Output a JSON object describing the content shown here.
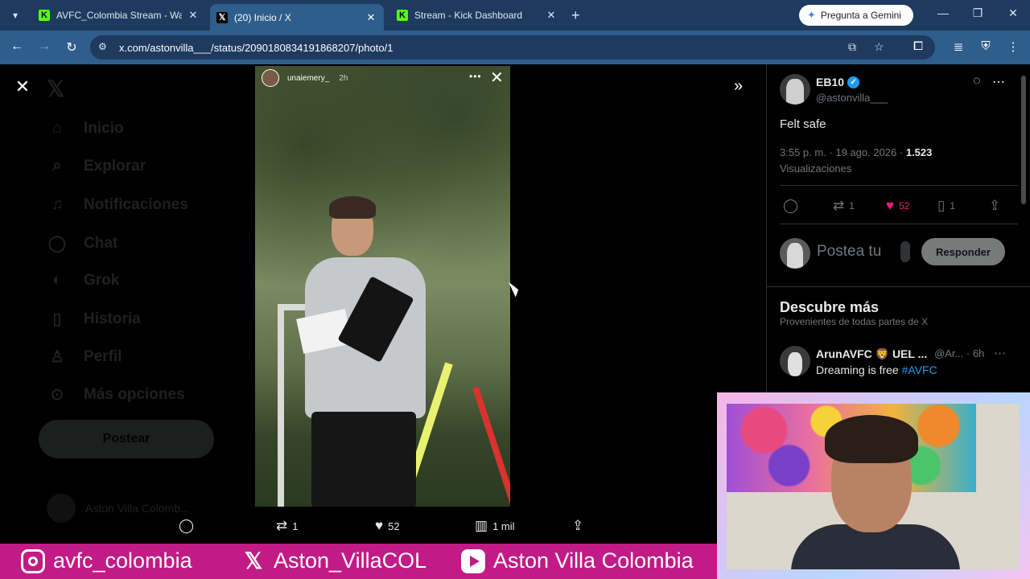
{
  "browser": {
    "tabs": [
      {
        "title": "AVFC_Colombia Stream - Watch",
        "favicon": "kick-icon",
        "active": false
      },
      {
        "title": "(20) Inicio / X",
        "favicon": "x-icon",
        "active": true
      },
      {
        "title": "Stream - Kick Dashboard",
        "favicon": "kick-icon",
        "active": false
      }
    ],
    "gemini_label": "Pregunta a Gemini",
    "url": "x.com/astonvilla___/status/2090180834191868207/photo/1"
  },
  "x_sidebar": {
    "items": [
      {
        "label": "Inicio",
        "icon": "home-icon"
      },
      {
        "label": "Explorar",
        "icon": "search-icon"
      },
      {
        "label": "Notificaciones",
        "icon": "bell-icon"
      },
      {
        "label": "Chat",
        "icon": "chat-icon"
      },
      {
        "label": "Grok",
        "icon": "grok-icon"
      },
      {
        "label": "Historia",
        "icon": "bookmark-icon"
      },
      {
        "label": "Perfil",
        "icon": "person-icon"
      },
      {
        "label": "Más opciones",
        "icon": "more-icon"
      }
    ],
    "post_label": "Postear",
    "account_name": "Aston Villa Colomb..."
  },
  "story": {
    "username": "unaiemery_",
    "time": "2h"
  },
  "photo_actions": {
    "retweets": "1",
    "likes": "52",
    "views": "1 mil"
  },
  "tweet": {
    "author_name": "EB10",
    "author_handle": "@astonvilla___",
    "text": "Felt safe",
    "timestamp": "3:55 p. m. · 19 ago. 2026 ·",
    "views_count": "1.523",
    "views_label": "Visualizaciones",
    "retweets": "1",
    "likes": "52",
    "bookmarks": "1"
  },
  "reply": {
    "placeholder": "Postea tu",
    "button": "Responder"
  },
  "discover": {
    "title": "Descubre más",
    "subtitle": "Provenientes de todas partes de X",
    "post": {
      "name": "ArunAVFC 🦁 UEL ...",
      "handle": "@Ar... · 6h",
      "text": "Dreaming is free ",
      "hashtag": "#AVFC"
    }
  },
  "banner": {
    "instagram": "avfc_colombia",
    "x": "Aston_VillaCOL",
    "youtube": "Aston Villa Colombia"
  },
  "colors": {
    "banner": "#c21a86",
    "like": "#f91880",
    "link": "#1d9bf0"
  }
}
